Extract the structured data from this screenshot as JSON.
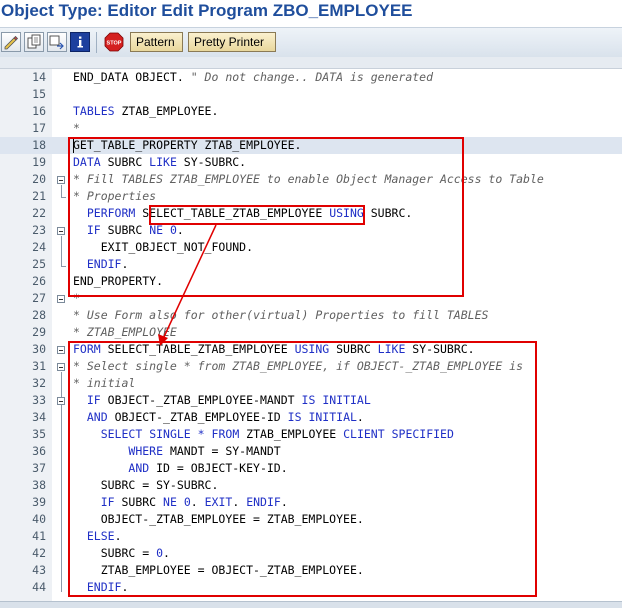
{
  "window": {
    "title": "Object Type: Editor Edit Program ZBO_EMPLOYEE"
  },
  "toolbar": {
    "icons": [
      "edit-pencil-icon",
      "display-change-icon",
      "navigate-icon",
      "info-icon",
      "stop-icon"
    ],
    "pattern_label": "Pattern",
    "pretty_printer_label": "Pretty Printer"
  },
  "editor": {
    "current_line": "18",
    "lines": [
      {
        "num": "14",
        "text": "END_DATA OBJECT. \" Do not change.. DATA is generated"
      },
      {
        "num": "15",
        "text": ""
      },
      {
        "num": "16",
        "text": "TABLES ZTAB_EMPLOYEE."
      },
      {
        "num": "17",
        "text": "*"
      },
      {
        "num": "18",
        "text": "GET_TABLE_PROPERTY ZTAB_EMPLOYEE."
      },
      {
        "num": "19",
        "text": "DATA SUBRC LIKE SY-SUBRC."
      },
      {
        "num": "20",
        "text": "* Fill TABLES ZTAB_EMPLOYEE to enable Object Manager Access to Table"
      },
      {
        "num": "21",
        "text": "* Properties"
      },
      {
        "num": "22",
        "text": "  PERFORM SELECT_TABLE_ZTAB_EMPLOYEE USING SUBRC."
      },
      {
        "num": "23",
        "text": "  IF SUBRC NE 0."
      },
      {
        "num": "24",
        "text": "    EXIT_OBJECT_NOT_FOUND."
      },
      {
        "num": "25",
        "text": "  ENDIF."
      },
      {
        "num": "26",
        "text": "END_PROPERTY."
      },
      {
        "num": "27",
        "text": "*"
      },
      {
        "num": "28",
        "text": "* Use Form also for other(virtual) Properties to fill TABLES"
      },
      {
        "num": "29",
        "text": "* ZTAB_EMPLOYEE"
      },
      {
        "num": "30",
        "text": "FORM SELECT_TABLE_ZTAB_EMPLOYEE USING SUBRC LIKE SY-SUBRC."
      },
      {
        "num": "31",
        "text": "* Select single * from ZTAB_EMPLOYEE, if OBJECT-_ZTAB_EMPLOYEE is"
      },
      {
        "num": "32",
        "text": "* initial"
      },
      {
        "num": "33",
        "text": "  IF OBJECT-_ZTAB_EMPLOYEE-MANDT IS INITIAL"
      },
      {
        "num": "34",
        "text": "  AND OBJECT-_ZTAB_EMPLOYEE-ID IS INITIAL."
      },
      {
        "num": "35",
        "text": "    SELECT SINGLE * FROM ZTAB_EMPLOYEE CLIENT SPECIFIED"
      },
      {
        "num": "36",
        "text": "        WHERE MANDT = SY-MANDT"
      },
      {
        "num": "37",
        "text": "        AND ID = OBJECT-KEY-ID."
      },
      {
        "num": "38",
        "text": "    SUBRC = SY-SUBRC."
      },
      {
        "num": "39",
        "text": "    IF SUBRC NE 0. EXIT. ENDIF."
      },
      {
        "num": "40",
        "text": "    OBJECT-_ZTAB_EMPLOYEE = ZTAB_EMPLOYEE."
      },
      {
        "num": "41",
        "text": "  ELSE."
      },
      {
        "num": "42",
        "text": "    SUBRC = 0."
      },
      {
        "num": "43",
        "text": "    ZTAB_EMPLOYEE = OBJECT-_ZTAB_EMPLOYEE."
      },
      {
        "num": "44",
        "text": "  ENDIF."
      }
    ]
  },
  "colors": {
    "title": "#1f4e9c",
    "keyword": "#1f2fc6",
    "comment": "#606060",
    "highlight_box": "#e00000",
    "current_line_bg": "#dde5f0"
  }
}
